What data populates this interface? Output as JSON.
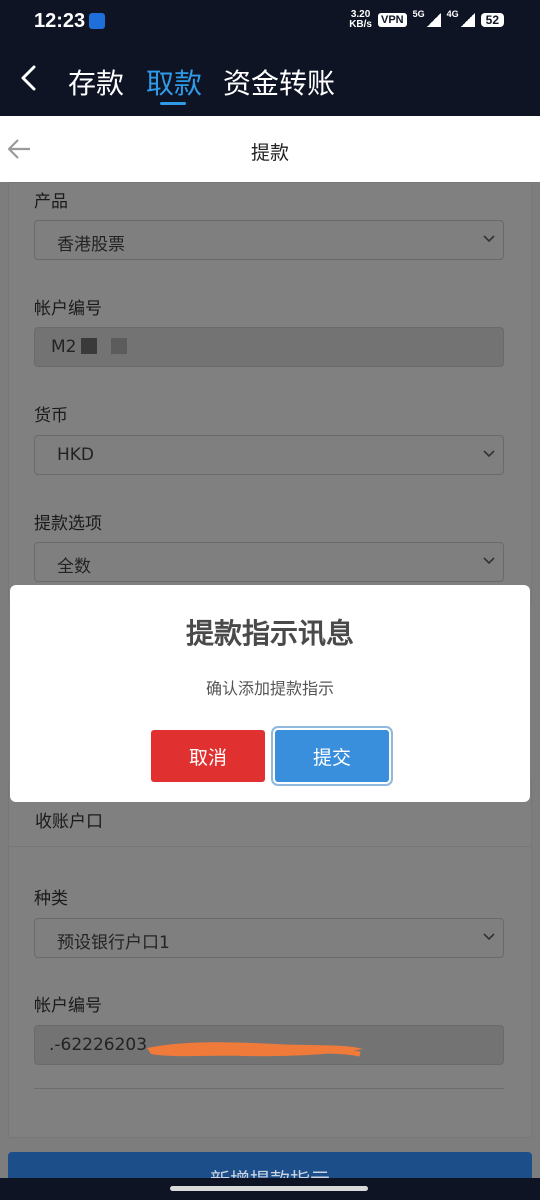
{
  "status_bar": {
    "time": "12:23",
    "speed_value": "3.20",
    "speed_unit": "KB/s",
    "vpn": "VPN",
    "net1": "5G",
    "net2": "4G",
    "battery": "52"
  },
  "nav": {
    "tabs": [
      {
        "label": "存款",
        "active": false
      },
      {
        "label": "取款",
        "active": true
      },
      {
        "label": "资金转账",
        "active": false
      }
    ]
  },
  "sub_header": {
    "title": "提款"
  },
  "form": {
    "product_label": "产品",
    "product_value": "香港股票",
    "account_label": "帐户编号",
    "account_value": "M2",
    "currency_label": "货币",
    "currency_value": "HKD",
    "withdraw_option_label": "提款选项",
    "withdraw_option_value": "全数"
  },
  "receiving": {
    "section_title": "收账户口",
    "type_label": "种类",
    "type_value": "预设银行户口1",
    "account_label": "帐户编号",
    "account_value": ".-62226203"
  },
  "bottom_button": {
    "label": "新增提款指示"
  },
  "modal": {
    "title": "提款指示讯息",
    "message": "确认添加提款指示",
    "cancel": "取消",
    "submit": "提交"
  },
  "colors": {
    "accent": "#2f9be8",
    "cancel": "#e03030",
    "submit": "#3a8fdc",
    "nav_bg": "#0f1424"
  }
}
